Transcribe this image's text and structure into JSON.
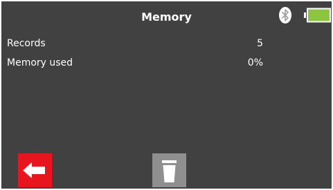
{
  "header": {
    "title": "Memory"
  },
  "status": {
    "bluetooth_icon": "bluetooth-icon",
    "battery_icon": "battery-icon",
    "battery_level": 1.0,
    "battery_color": "#8cc63f"
  },
  "rows": [
    {
      "label": "Records",
      "value": "5"
    },
    {
      "label": "Memory used",
      "value": "0%"
    }
  ],
  "buttons": {
    "back_icon": "arrow-left-icon",
    "back_color": "#e8141e",
    "delete_icon": "trash-icon",
    "delete_color": "#8f8f8f"
  },
  "colors": {
    "background": "#414141"
  }
}
